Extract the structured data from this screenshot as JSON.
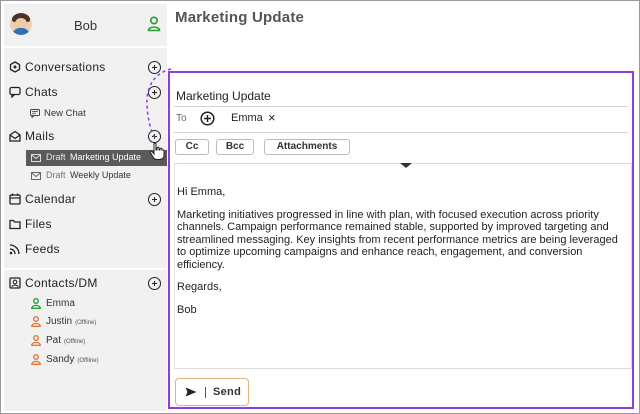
{
  "user": {
    "name": "Bob"
  },
  "page": {
    "title": "Marketing Update"
  },
  "sidebar": {
    "conversations": "Conversations",
    "chats": "Chats",
    "new_chat": "New Chat",
    "mails": "Mails",
    "drafts": [
      {
        "tag": "Draft",
        "title": "Marketing Update",
        "active": true
      },
      {
        "tag": "Draft",
        "title": "Weekly Update",
        "active": false
      }
    ],
    "calendar": "Calendar",
    "files": "Files",
    "feeds": "Feeds",
    "contacts": "Contacts/DM",
    "contact_list": [
      {
        "name": "Emma",
        "status": "",
        "color": "#22a02e"
      },
      {
        "name": "Justin",
        "status": "(Offline)",
        "color": "#e2773a"
      },
      {
        "name": "Pat",
        "status": "(Offline)",
        "color": "#e2773a"
      },
      {
        "name": "Sandy",
        "status": "(Offline)",
        "color": "#e2773a"
      }
    ]
  },
  "composer": {
    "subject": "Marketing Update",
    "to_label": "To",
    "recipient": "Emma",
    "remove_glyph": "×",
    "cc_label": "Cc",
    "bcc_label": "Bcc",
    "attachments_label": "Attachments",
    "greeting": "Hi Emma,",
    "paragraph": "Marketing initiatives progressed in line with plan, with focused execution across priority channels. Campaign performance remained stable, supported by improved targeting and streamlined messaging. Key insights from recent performance metrics are being leveraged to optimize upcoming campaigns and enhance reach, engagement, and conversion efficiency.",
    "closing": "Regards,",
    "signature": "Bob",
    "send_label": "Send"
  },
  "colors": {
    "composer_border": "#8a3ee0",
    "online": "#22a02e",
    "offline": "#e2773a",
    "send_border": "#e3b27a"
  }
}
